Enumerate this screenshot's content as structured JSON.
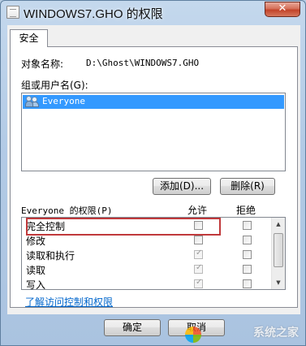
{
  "window": {
    "title": "WINDOWS7.GHO 的权限",
    "close_label": "✕"
  },
  "tabs": [
    {
      "label": "安全"
    }
  ],
  "object": {
    "label": "对象名称:",
    "value": "D:\\Ghost\\WINDOWS7.GHO"
  },
  "groups": {
    "label": "组或用户名(G):",
    "items": [
      {
        "name": "Everyone",
        "selected": true
      }
    ]
  },
  "buttons": {
    "add": "添加(D)...",
    "remove": "删除(R)",
    "ok": "确定",
    "cancel": "取消"
  },
  "permissions": {
    "label": "Everyone 的权限(P)",
    "allow_header": "允许",
    "deny_header": "拒绝",
    "rows": [
      {
        "name": "完全控制",
        "allow": false,
        "deny": false,
        "allow_inherited": false
      },
      {
        "name": "修改",
        "allow": false,
        "deny": false,
        "allow_inherited": false
      },
      {
        "name": "读取和执行",
        "allow": true,
        "deny": false,
        "allow_inherited": true
      },
      {
        "name": "读取",
        "allow": true,
        "deny": false,
        "allow_inherited": true
      },
      {
        "name": "写入",
        "allow": true,
        "deny": false,
        "allow_inherited": true
      }
    ]
  },
  "link": "了解访问控制和权限",
  "watermark": "系统之家",
  "colors": {
    "selection": "#3399ff",
    "link": "#0066cc",
    "highlight_box": "#c0393b"
  }
}
